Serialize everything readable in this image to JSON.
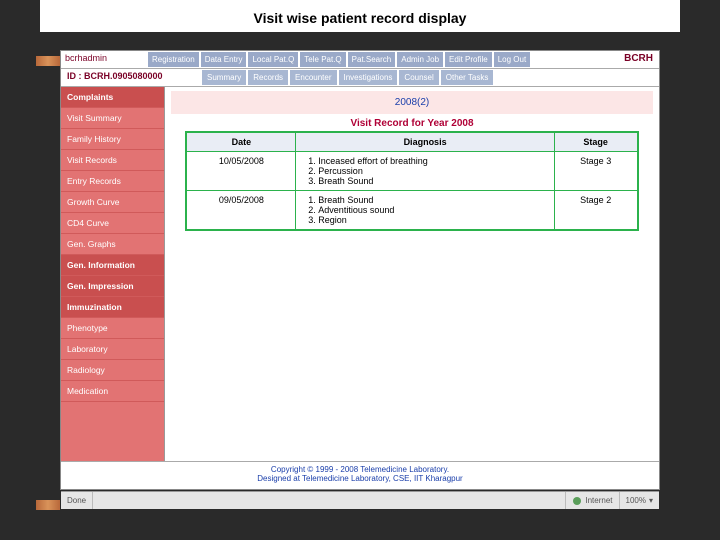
{
  "slide": {
    "caption": "Visit wise patient record display"
  },
  "brand": {
    "left": "bcrhadmin",
    "right": "BCRH"
  },
  "topnav": [
    "Registration",
    "Data Entry",
    "Local Pat.Q",
    "Tele Pat.Q",
    "Pat.Search",
    "Admin Job",
    "Edit Profile",
    "Log Out"
  ],
  "idbar": {
    "label": "ID : BCRH.0905080000"
  },
  "subnav": [
    "Summary",
    "Records",
    "Encounter",
    "Investigations",
    "Counsel",
    "Other Tasks"
  ],
  "sidebar": [
    {
      "label": "Complaints",
      "group": true
    },
    {
      "label": "Visit Summary"
    },
    {
      "label": "Family History"
    },
    {
      "label": "Visit Records"
    },
    {
      "label": "Entry Records"
    },
    {
      "label": "Growth Curve"
    },
    {
      "label": "CD4 Curve"
    },
    {
      "label": "Gen. Graphs"
    },
    {
      "label": "Gen. Information",
      "group": true
    },
    {
      "label": "Gen. Impression",
      "group": true
    },
    {
      "label": "Immuzination",
      "group": true
    },
    {
      "label": "Phenotype"
    },
    {
      "label": "Laboratory"
    },
    {
      "label": "Radiology"
    },
    {
      "label": "Medication"
    }
  ],
  "main": {
    "year_band": "2008(2)",
    "record_title": "Visit Record for Year 2008",
    "columns": [
      "Date",
      "Diagnosis",
      "Stage"
    ],
    "rows": [
      {
        "date": "10/05/2008",
        "diagnosis": [
          "Inceased effort of breathing",
          "Percussion",
          "Breath Sound"
        ],
        "stage": "Stage 3"
      },
      {
        "date": "09/05/2008",
        "diagnosis": [
          "Breath Sound",
          "Adventitious sound",
          "Region"
        ],
        "stage": "Stage 2"
      }
    ]
  },
  "footer": {
    "line1": "Copyright © 1999 - 2008 Telemedicine Laboratory.",
    "line2": "Designed at Telemedicine Laboratory, CSE, IIT Kharagpur"
  },
  "status": {
    "left": "Done",
    "zone": "Internet",
    "zoom": "100%"
  }
}
